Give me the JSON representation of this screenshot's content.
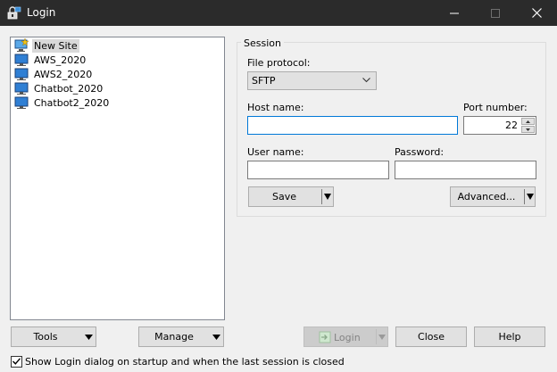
{
  "window": {
    "title": "Login",
    "app_icon": "winscp-icon",
    "controls": [
      "minimize-icon",
      "maximize-icon",
      "close-icon"
    ]
  },
  "sites": [
    {
      "label": "New Site",
      "icon": "new-site-icon",
      "selected": true
    },
    {
      "label": "AWS_2020",
      "icon": "monitor-icon",
      "selected": false
    },
    {
      "label": "AWS2_2020",
      "icon": "monitor-icon",
      "selected": false
    },
    {
      "label": "Chatbot_2020",
      "icon": "monitor-icon",
      "selected": false
    },
    {
      "label": "Chatbot2_2020",
      "icon": "monitor-icon",
      "selected": false
    }
  ],
  "session": {
    "group_title": "Session",
    "file_protocol_label": "File protocol:",
    "file_protocol_value": "SFTP",
    "host_name_label": "Host name:",
    "host_name_value": "",
    "port_number_label": "Port number:",
    "port_number_value": "22",
    "user_name_label": "User name:",
    "user_name_value": "",
    "password_label": "Password:",
    "password_value": "",
    "save_button": "Save",
    "advanced_button": "Advanced..."
  },
  "footer": {
    "tools_button": "Tools",
    "manage_button": "Manage",
    "login_button": "Login",
    "close_button": "Close",
    "help_button": "Help",
    "startup_checkbox_label": "Show Login dialog on startup and when the last session is closed",
    "startup_checkbox_checked": true
  },
  "colors": {
    "titlebar": "#2b2b2b",
    "focus_border": "#0078d7",
    "selection": "#d9d9d9",
    "dialog_bg": "#f0f0f0"
  }
}
